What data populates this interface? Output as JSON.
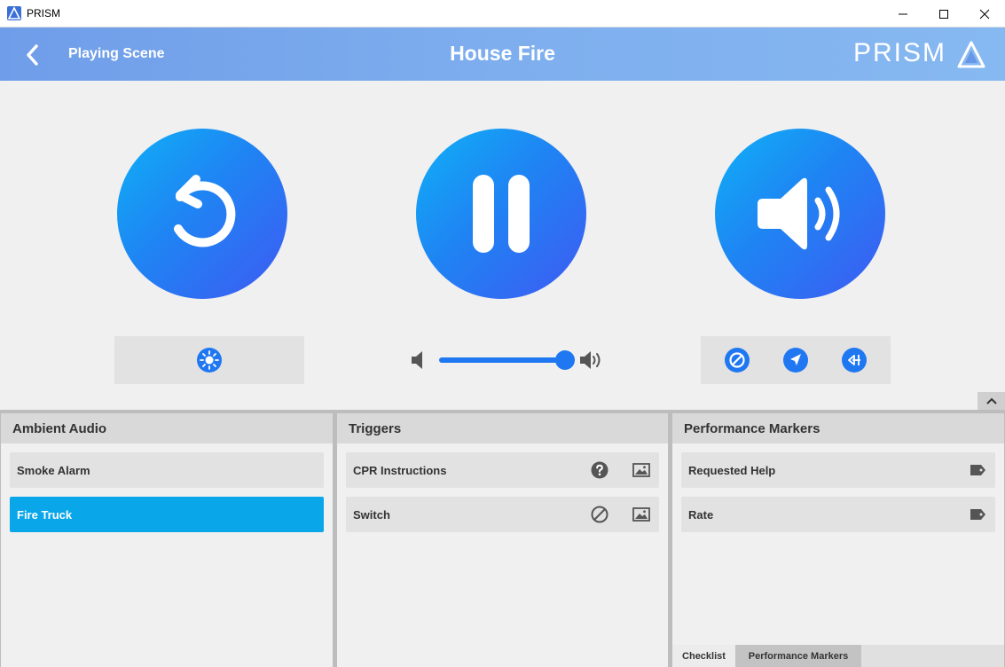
{
  "window": {
    "app_name": "PRISM"
  },
  "header": {
    "subtitle": "Playing Scene",
    "title": "House Fire",
    "brand": "PRISM"
  },
  "colors": {
    "accent": "#1f78f1",
    "active_item": "#0aa6ea",
    "header_gradient": [
      "#6f9de9",
      "#86b8f1"
    ]
  },
  "volume": {
    "level_percent": 100
  },
  "panels": {
    "ambient": {
      "title": "Ambient Audio",
      "items": [
        {
          "label": "Smoke Alarm",
          "active": false
        },
        {
          "label": "Fire Truck",
          "active": true
        }
      ]
    },
    "triggers": {
      "title": "Triggers",
      "items": [
        {
          "label": "CPR Instructions",
          "status_icon": "question-icon",
          "media_icon": "image-icon"
        },
        {
          "label": "Switch",
          "status_icon": "blocked-icon",
          "media_icon": "image-icon"
        }
      ]
    },
    "markers": {
      "title": "Performance Markers",
      "items": [
        {
          "label": "Requested Help",
          "icon": "tag-icon"
        },
        {
          "label": "Rate",
          "icon": "tag-icon"
        }
      ],
      "tabs": [
        {
          "label": "Checklist"
        },
        {
          "label": "Performance Markers"
        }
      ]
    }
  }
}
